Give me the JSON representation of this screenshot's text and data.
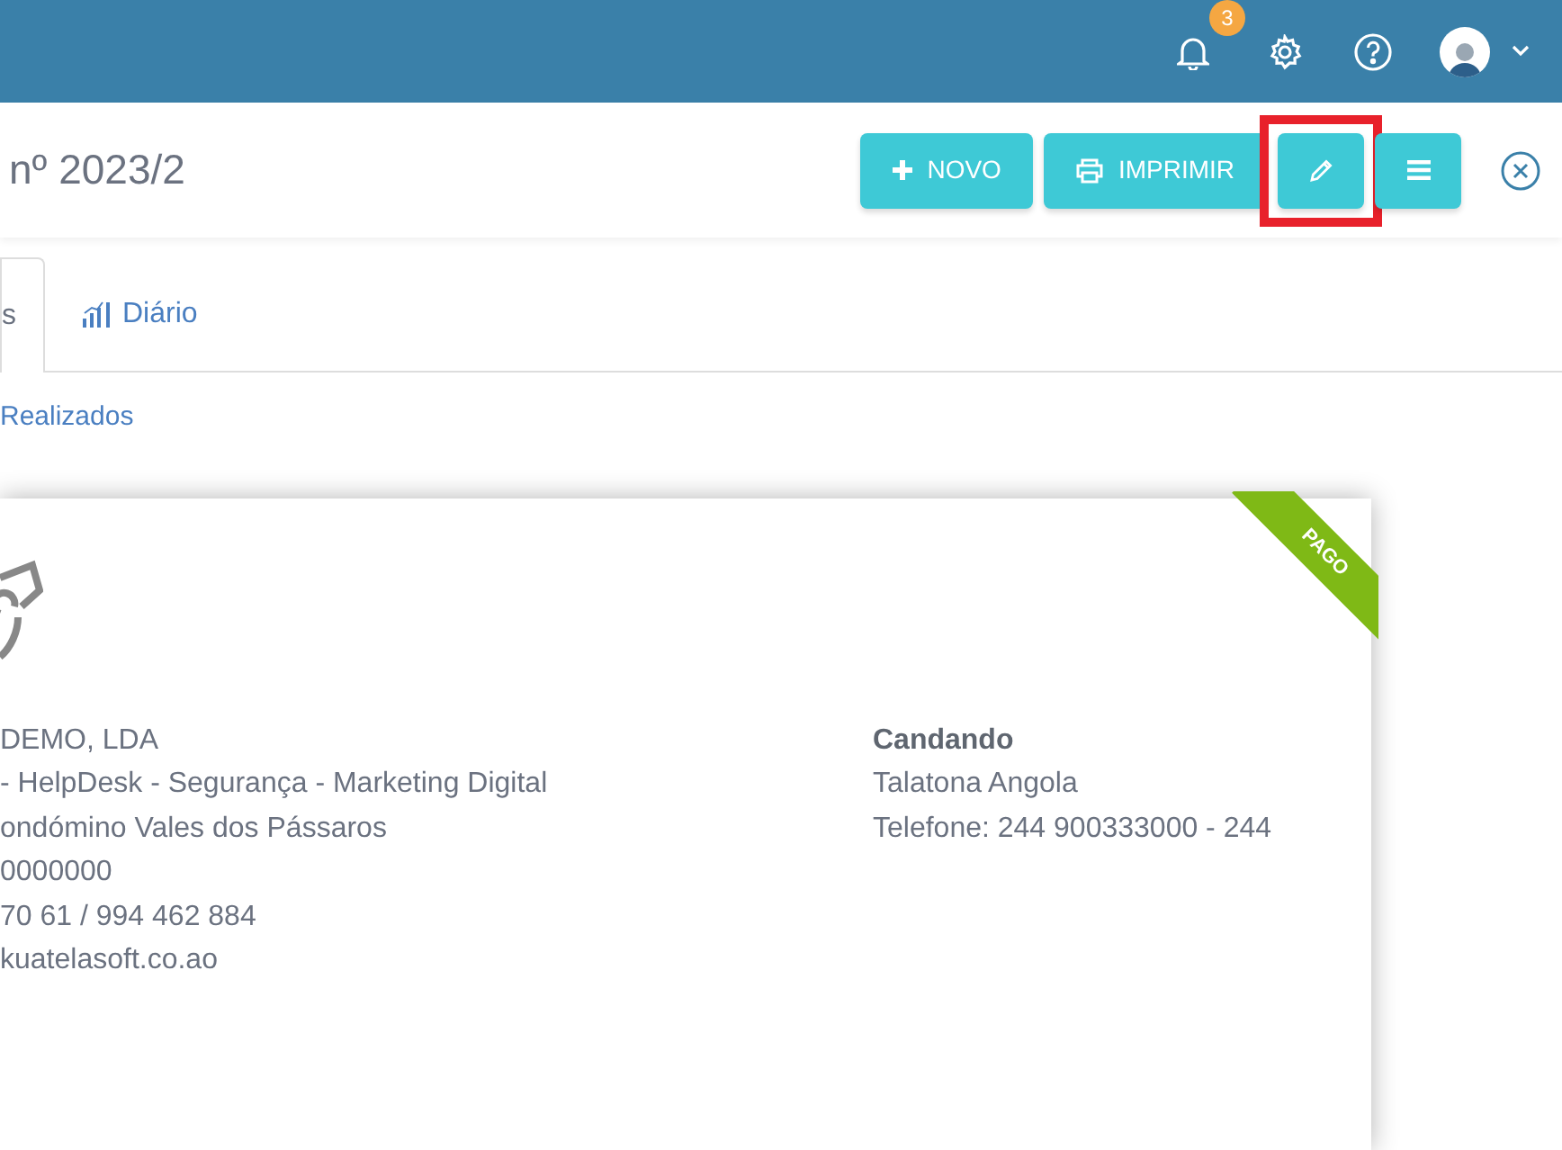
{
  "topbar": {
    "notifications": {
      "count": "3"
    }
  },
  "header": {
    "title": "nº 2023/2",
    "buttons": [
      {
        "kind": "plus",
        "label": "NOVO"
      },
      {
        "kind": "print",
        "label": "IMPRIMIR"
      },
      {
        "kind": "edit",
        "highlighted": true
      },
      {
        "kind": "menu",
        "highlighted": false
      }
    ]
  },
  "tabs": [
    {
      "label": "s",
      "selected": true
    },
    {
      "label": "Diário",
      "selected": false
    }
  ],
  "link": "Realizados",
  "document": {
    "ribbon": "PAGO",
    "company_lines": [
      "DEMO, LDA",
      "- HelpDesk - Segurança - Marketing Digital",
      "ondómino Vales dos Pássaros",
      "0000000",
      "70 61 / 994 462 884",
      "kuatelasoft.co.ao"
    ],
    "client": {
      "name": "Candando",
      "lines": [
        "Talatona Angola",
        "Telefone: 244 900333000 - 244"
      ]
    }
  }
}
